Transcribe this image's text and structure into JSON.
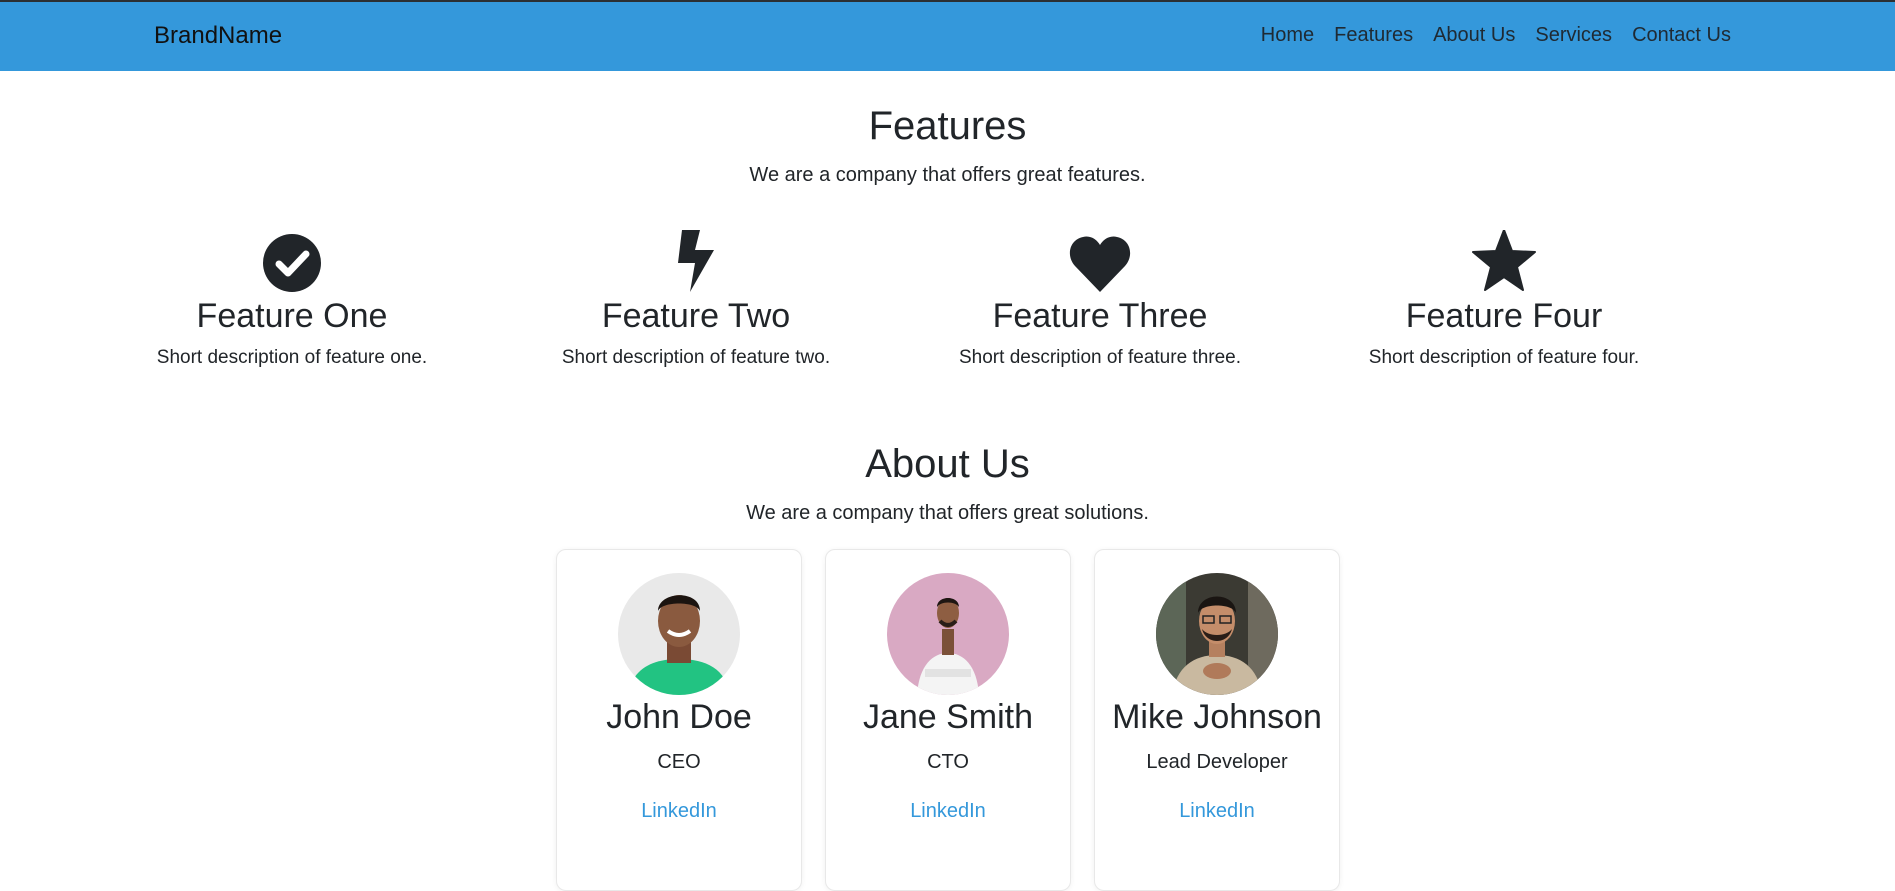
{
  "nav": {
    "brand": "BrandName",
    "links": [
      "Home",
      "Features",
      "About Us",
      "Services",
      "Contact Us"
    ]
  },
  "features": {
    "title": "Features",
    "subtitle": "We are a company that offers great features.",
    "items": [
      {
        "icon": "check-circle-icon",
        "title": "Feature One",
        "desc": "Short description of feature one."
      },
      {
        "icon": "bolt-icon",
        "title": "Feature Two",
        "desc": "Short description of feature two."
      },
      {
        "icon": "heart-icon",
        "title": "Feature Three",
        "desc": "Short description of feature three."
      },
      {
        "icon": "star-icon",
        "title": "Feature Four",
        "desc": "Short description of feature four."
      }
    ]
  },
  "about": {
    "title": "About Us",
    "subtitle": "We are a company that offers great solutions.",
    "members": [
      {
        "name": "John Doe",
        "role": "CEO",
        "link": "LinkedIn"
      },
      {
        "name": "Jane Smith",
        "role": "CTO",
        "link": "LinkedIn"
      },
      {
        "name": "Mike Johnson",
        "role": "Lead Developer",
        "link": "LinkedIn"
      }
    ]
  },
  "colors": {
    "navbar": "#3498db",
    "link": "#3498db",
    "text": "#212529"
  }
}
